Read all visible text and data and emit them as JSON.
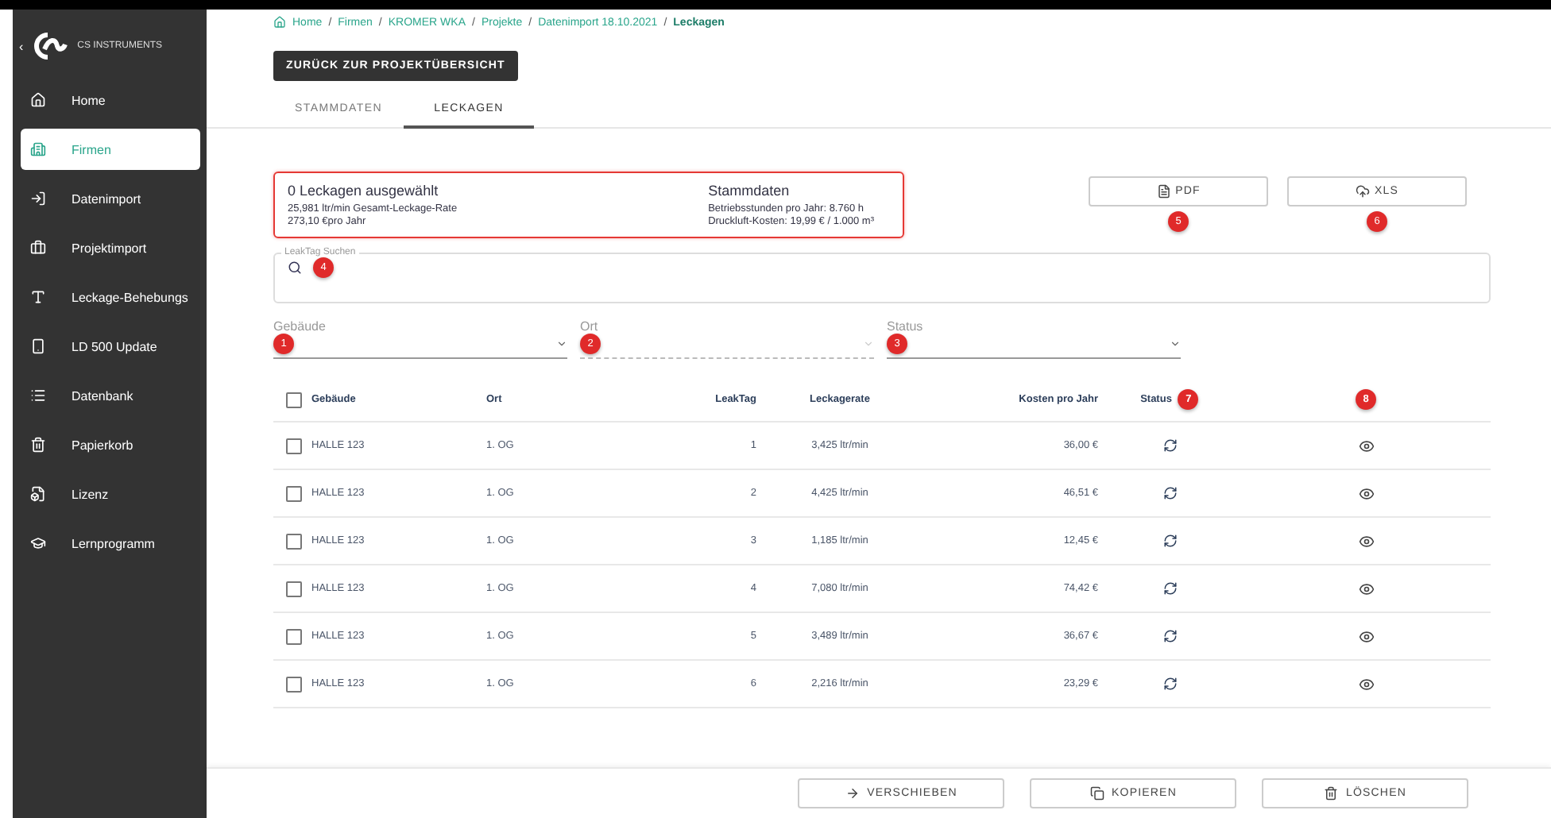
{
  "sidebar": {
    "brand": "CS INSTRUMENTS",
    "collapse": "‹",
    "items": [
      {
        "label": "Home",
        "selected": false
      },
      {
        "label": "Firmen",
        "selected": true
      },
      {
        "label": "Datenimport",
        "selected": false
      },
      {
        "label": "Projektimport",
        "selected": false
      },
      {
        "label": "Leckage-Behebungs",
        "selected": false
      },
      {
        "label": "LD 500 Update",
        "selected": false
      },
      {
        "label": "Datenbank",
        "selected": false
      },
      {
        "label": "Papierkorb",
        "selected": false
      },
      {
        "label": "Lizenz",
        "selected": false
      },
      {
        "label": "Lernprogramm",
        "selected": false
      }
    ]
  },
  "breadcrumb": {
    "separator": "/",
    "items": [
      "Home",
      "Firmen",
      "KROMER WKA",
      "Projekte",
      "Datenimport 18.10.2021",
      "Leckagen"
    ]
  },
  "back_button": "ZURÜCK ZUR PROJEKTÜBERSICHT",
  "tabs": [
    {
      "label": "STAMMDATEN",
      "selected": false
    },
    {
      "label": "LECKAGEN",
      "selected": true
    }
  ],
  "summary": {
    "title": "0 Leckagen ausgewählt",
    "lines": [
      "25,981 ltr/min Gesamt-Leckage-Rate",
      "273,10 €pro Jahr"
    ],
    "master_title": "Stammdaten",
    "master_lines": [
      "Betriebsstunden pro Jahr: 8.760 h",
      "Druckluft-Kosten: 19,99 € / 1.000 m³"
    ]
  },
  "exports": [
    {
      "label": "PDF",
      "marker": "5"
    },
    {
      "label": "XLS",
      "marker": "6"
    }
  ],
  "search": {
    "label": "LeakTag Suchen",
    "marker": "4"
  },
  "filters": [
    {
      "label": "Gebäude",
      "marker": "1",
      "disabled": false
    },
    {
      "label": "Ort",
      "marker": "2",
      "disabled": true
    },
    {
      "label": "Status",
      "marker": "3",
      "disabled": false
    }
  ],
  "table": {
    "all_checked": false,
    "columns": [
      {
        "label": "Gebäude"
      },
      {
        "label": "Ort"
      },
      {
        "label": "LeakTag"
      },
      {
        "label": "Leckagerate"
      },
      {
        "label": "Kosten pro Jahr"
      },
      {
        "label": "Status",
        "marker": "7"
      },
      {
        "marker": "8"
      }
    ],
    "rows": [
      {
        "cells": [
          "HALLE 123",
          "1. OG",
          "1",
          "3,425 ltr/min",
          "36,00 €"
        ],
        "checked": false
      },
      {
        "cells": [
          "HALLE 123",
          "1. OG",
          "2",
          "4,425 ltr/min",
          "46,51 €"
        ],
        "checked": false
      },
      {
        "cells": [
          "HALLE 123",
          "1. OG",
          "3",
          "1,185 ltr/min",
          "12,45 €"
        ],
        "checked": false
      },
      {
        "cells": [
          "HALLE 123",
          "1. OG",
          "4",
          "7,080 ltr/min",
          "74,42 €"
        ],
        "checked": false
      },
      {
        "cells": [
          "HALLE 123",
          "1. OG",
          "5",
          "3,489 ltr/min",
          "36,67 €"
        ],
        "checked": false
      },
      {
        "cells": [
          "HALLE 123",
          "1. OG",
          "6",
          "2,216 ltr/min",
          "23,29 €"
        ],
        "checked": false
      }
    ]
  },
  "actions": [
    "VERSCHIEBEN",
    "KOPIEREN",
    "LÖSCHEN"
  ]
}
